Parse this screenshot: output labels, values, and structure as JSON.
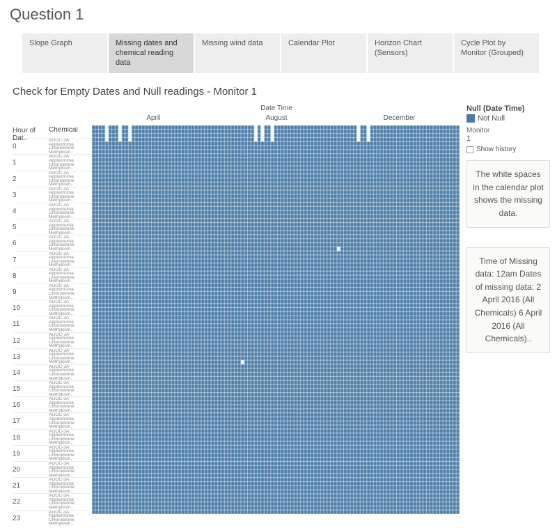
{
  "page_title": "Question 1",
  "tabs": [
    {
      "label": "Slope Graph",
      "active": false
    },
    {
      "label": "Missing dates and chemical reading data",
      "active": true
    },
    {
      "label": "Missing wind data",
      "active": false
    },
    {
      "label": "Calendar Plot",
      "active": false
    },
    {
      "label": "Horizon Chart (Sensors)",
      "active": false
    },
    {
      "label": "Cycle Plot by Monitor (Grouped)",
      "active": false
    }
  ],
  "chart_title": "Check for Empty Dates and Null readings - Monitor 1",
  "axis": {
    "x_title": "Date Time",
    "months": [
      "April",
      "August",
      "December"
    ],
    "row_head": "Hour of Dat..",
    "chem_head": "Chemical"
  },
  "hours": [
    "0",
    "1",
    "2",
    "3",
    "4",
    "5",
    "6",
    "7",
    "8",
    "9",
    "10",
    "11",
    "12",
    "13",
    "14",
    "15",
    "16",
    "17",
    "18",
    "19",
    "20",
    "21",
    "22",
    "23"
  ],
  "chemicals": [
    "AGOC-3A",
    "Appluimonia",
    "Chlorodinine",
    "Methylosm.."
  ],
  "legend": {
    "title": "Null (Date Time)",
    "item": "Not Null",
    "color": "#4a7ba6"
  },
  "filter": {
    "label": "Monitor",
    "value": "1",
    "show_history": "Show history"
  },
  "annotations": {
    "a1": "The white spaces in the calendar plot shows the missing data.",
    "a2": "Time of Missing data: 12am Dates of missing data: 2 April 2016 (All Chemicals) 6 April 2016 (All Chemicals).."
  },
  "chart_data": {
    "type": "heatmap",
    "description": "Calendar-style heatmap. Columns = days across 2016 (April through December shown via month ticks). Rows = 24 hours × 4 chemicals each. Cell filled blue = reading present (Not Null); white = missing.",
    "x": "date (day of year 2016)",
    "y": "hour (0-23) × chemical",
    "fill_color": "#4a7ba6",
    "days": 275,
    "pixel_days": 111,
    "gaps": [
      {
        "day_index": 4,
        "hour": 0,
        "chems": "all",
        "width_days": 1,
        "note": "2 Apr 2016"
      },
      {
        "day_index": 8,
        "hour": 0,
        "chems": "all",
        "width_days": 1,
        "note": "6 Apr 2016"
      },
      {
        "day_index": 11,
        "hour": 0,
        "chems": "all",
        "width_days": 1
      },
      {
        "day_index": 49,
        "hour": 0,
        "chems": "all",
        "width_days": 1
      },
      {
        "day_index": 51,
        "hour": 0,
        "chems": "all",
        "width_days": 1
      },
      {
        "day_index": 54,
        "hour": 0,
        "chems": "all",
        "width_days": 1
      },
      {
        "day_index": 80,
        "hour": 0,
        "chems": "all",
        "width_days": 1
      },
      {
        "day_index": 83,
        "hour": 0,
        "chems": "all",
        "width_days": 1
      },
      {
        "day_index": 74,
        "hour": 7,
        "chems": [
          2
        ],
        "width_days": 1
      },
      {
        "day_index": 45,
        "hour": 14,
        "chems": [
          2
        ],
        "width_days": 1
      }
    ]
  }
}
